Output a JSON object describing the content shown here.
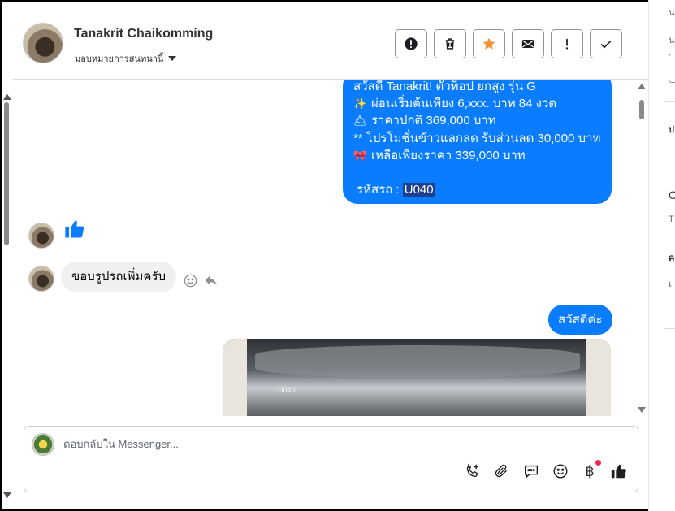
{
  "header": {
    "contact_name": "Tanakrit Chaikomming",
    "assign_label": "มอบหมายการสนทนานี้",
    "actions": [
      {
        "name": "spam-button",
        "icon": "alert-circle-icon"
      },
      {
        "name": "delete-button",
        "icon": "trash-icon"
      },
      {
        "name": "star-button",
        "icon": "star-icon"
      },
      {
        "name": "mark-unread-button",
        "icon": "envelope-icon"
      },
      {
        "name": "follow-up-button",
        "icon": "exclamation-icon"
      },
      {
        "name": "mark-done-button",
        "icon": "check-icon"
      }
    ]
  },
  "messages": {
    "outgoing_promo": {
      "lines": [
        {
          "emoji": "",
          "text": "สวัสดี Tanakrit! ตัวท็อป ยกสูง รุ่น G"
        },
        {
          "emoji": "✨",
          "text": " ผ่อนเริ่มต้นเพียง 6,xxx. บาท 84 งวด"
        },
        {
          "emoji": "🛎",
          "text": "ราคาปกติ 369,000 บาท"
        },
        {
          "emoji": "",
          "text": "** โปรโมชั่นข้าวแลกลด รับส่วนลด 30,000 บาท"
        },
        {
          "emoji": "🎀",
          "text": " เหลือเพียงราคา 339,000 บาท"
        }
      ],
      "code_label": "รหัสรถ : ",
      "code_value": "U040"
    },
    "incoming_text": "ขอบรูปรถเพิ่มครับ",
    "outgoing_greeting": "สวัสดีค่ะ",
    "photo_plate": "U040"
  },
  "composer": {
    "placeholder": "ตอบกลับใน Messenger...",
    "tools": [
      "phone-plus-icon",
      "paperclip-icon",
      "speech-bubble-icon",
      "smiley-icon",
      "baht-icon",
      "thumbs-up-icon"
    ],
    "baht_symbol": "฿"
  },
  "colors": {
    "accent": "#0a7cff",
    "star": "#f7923a",
    "highlight": "#1c3f8f",
    "badge": "#f02849"
  }
}
